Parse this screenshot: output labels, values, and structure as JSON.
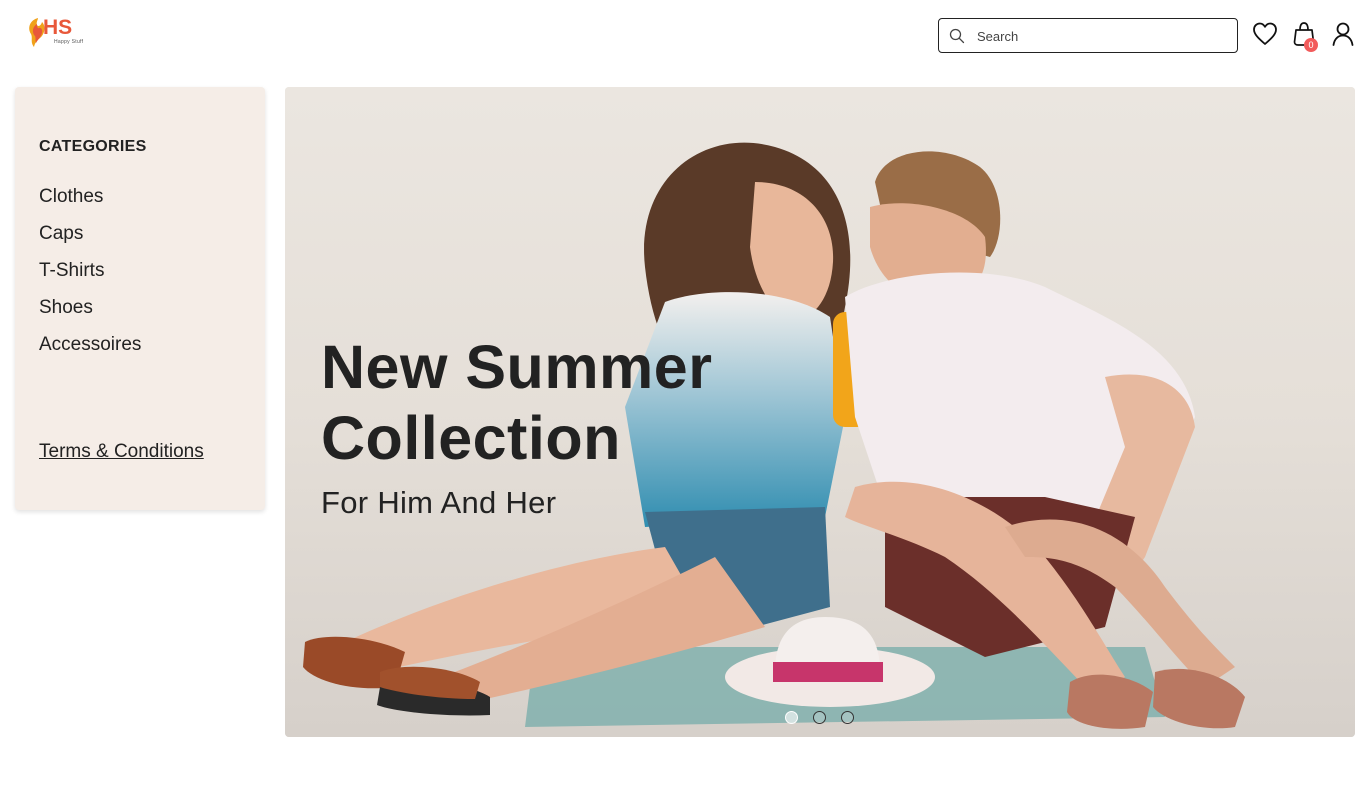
{
  "brand": {
    "logo_text": "HS",
    "tagline": "Happy Stuff",
    "color": "#e8583a"
  },
  "search": {
    "placeholder": "Search",
    "value": ""
  },
  "header_icons": {
    "wishlist": "heart-icon",
    "cart": "shopping-bag-icon",
    "account": "user-icon",
    "cart_count": "0",
    "badge_color": "#f25b5b"
  },
  "sidebar": {
    "title": "CATEGORIES",
    "items": [
      {
        "label": "Clothes"
      },
      {
        "label": "Caps"
      },
      {
        "label": "T-Shirts"
      },
      {
        "label": "Shoes"
      },
      {
        "label": "Accessoires"
      }
    ],
    "terms_label": "Terms & Conditions",
    "background": "#f5ede7"
  },
  "hero": {
    "title_line1": "New Summer",
    "title_line2": "Collection",
    "subtitle": "For Him And Her",
    "slides_total": 3,
    "active_slide": 1
  }
}
